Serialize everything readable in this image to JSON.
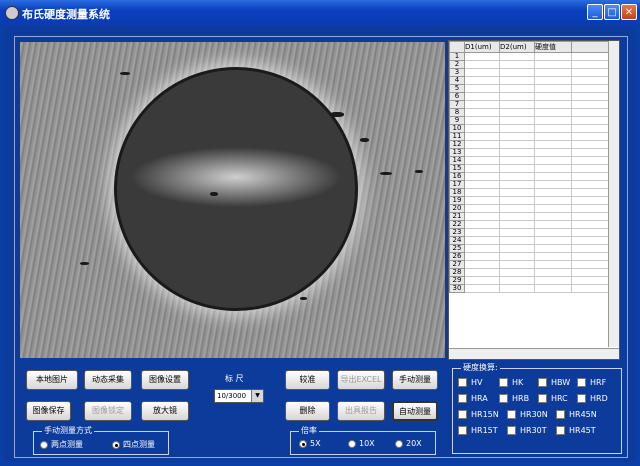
{
  "window": {
    "title": "布氏硬度测量系统"
  },
  "grid": {
    "columns": [
      "D1(um)",
      "D2(um)",
      "硬度值"
    ],
    "rows": [
      "1",
      "2",
      "3",
      "4",
      "5",
      "6",
      "7",
      "8",
      "9",
      "10",
      "11",
      "12",
      "13",
      "14",
      "15",
      "16",
      "17",
      "18",
      "19",
      "20",
      "21",
      "22",
      "23",
      "24",
      "25",
      "26",
      "27",
      "28",
      "29",
      "30"
    ]
  },
  "buttons": {
    "local_image": "本地图片",
    "dynamic_capture": "动态采集",
    "image_settings": "图像设置",
    "calibrate": "较准",
    "export_excel": "导出EXCEL",
    "manual_measure": "手动测量",
    "save_image": "图像保存",
    "lock_image": "图像锁定",
    "magnifier": "放大镜",
    "delete": "删除",
    "report": "出具报告",
    "auto_measure": "自动测量"
  },
  "scale": {
    "label": "标 尺",
    "value": "10/3000"
  },
  "manual_mode": {
    "title": "手动测量方式",
    "opt1": "两点测量",
    "opt2": "四点测量",
    "selected": "opt2"
  },
  "magnification": {
    "title": "倍率",
    "opt1": "5X",
    "opt2": "10X",
    "opt3": "20X",
    "selected": "opt1"
  },
  "conversion": {
    "title": "硬度换算:",
    "items": [
      "HV",
      "HK",
      "HBW",
      "HRF",
      "HRA",
      "HRB",
      "HRC",
      "HRD",
      "HR15N",
      "HR30N",
      "HR45N",
      "HR15T",
      "HR30T",
      "HR45T"
    ]
  }
}
